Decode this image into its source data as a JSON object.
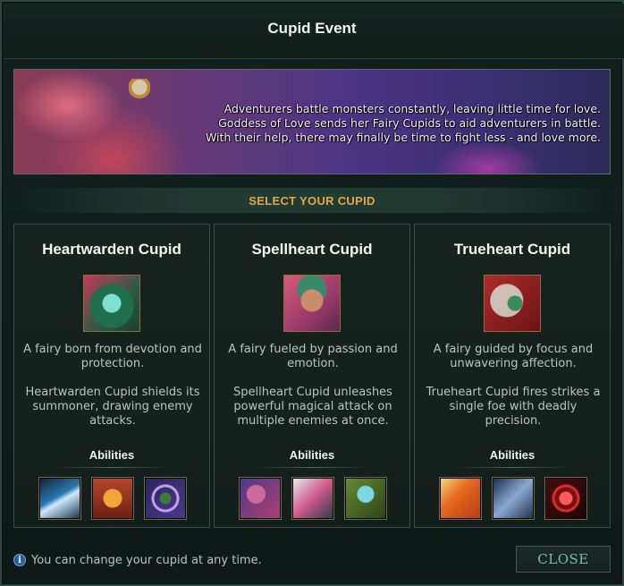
{
  "window": {
    "title": "Cupid Event"
  },
  "banner": {
    "lines": [
      "Adventurers battle monsters constantly, leaving little time for love.",
      "Goddess of Love sends her Fairy Cupids to aid adventurers in battle.",
      "With their help, there may finally be time to fight less - and love more."
    ]
  },
  "section": {
    "label": "SELECT YOUR CUPID"
  },
  "cupids": [
    {
      "name": "Heartwarden Cupid",
      "portrait_icon": "heartwarden-portrait",
      "desc": "A fairy born from devotion and protection.",
      "desc2": "Heartwarden Cupid shields its summoner, drawing enemy attacks.",
      "abilities_label": "Abilities",
      "abilities": [
        "blade-ability-icon",
        "fairy-ward-ability-icon",
        "swirl-ability-icon"
      ]
    },
    {
      "name": "Spellheart Cupid",
      "portrait_icon": "spellheart-portrait",
      "desc": "A fairy fueled by passion and emotion.",
      "desc2": "Spellheart Cupid unleashes powerful magical attack on multiple enemies at once.",
      "abilities_label": "Abilities",
      "abilities": [
        "mage-ability-icon",
        "dash-ability-icon",
        "heart-ability-icon"
      ]
    },
    {
      "name": "Trueheart Cupid",
      "portrait_icon": "trueheart-portrait",
      "desc": "A fairy guided by focus and unwavering affection.",
      "desc2": "Trueheart Cupid fires strikes a single foe with deadly precision.",
      "abilities_label": "Abilities",
      "abilities": [
        "arrow-ability-icon",
        "bolt-ability-icon",
        "target-ability-icon"
      ]
    }
  ],
  "footer": {
    "info_icon": "info-icon",
    "info_text": "You can change your cupid at any time.",
    "close_label": "CLOSE"
  }
}
